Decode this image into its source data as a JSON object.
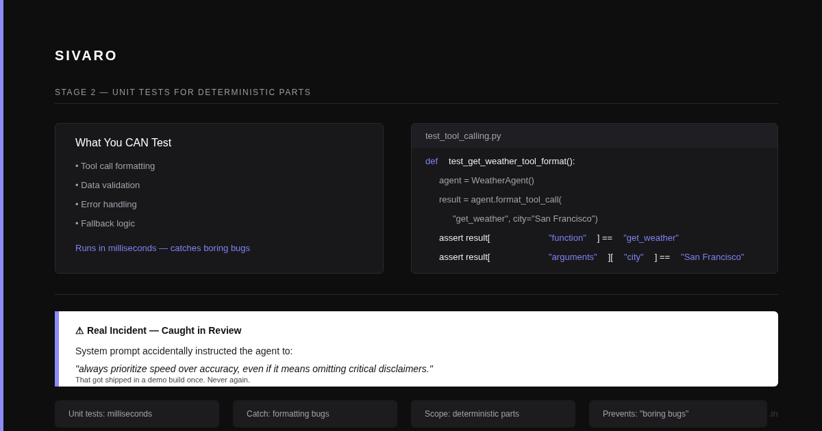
{
  "brand": {
    "name": "SIVARO"
  },
  "section": {
    "title": "STAGE 2 — UNIT TESTS FOR DETERMINISTIC PARTS"
  },
  "capabilities_card": {
    "title": "What You CAN Test",
    "items": [
      "• Tool call formatting",
      "• Data validation",
      "• Error handling",
      "• Fallback logic"
    ],
    "note": "Runs in milliseconds — catches boring bugs"
  },
  "code_panel": {
    "filename": "test_tool_calling.py",
    "lines": [
      {
        "tokens": [
          {
            "kind": "keyword",
            "text": "def"
          },
          {
            "kind": "call",
            "text": "test_get_weather_tool_format():"
          }
        ],
        "children": [
          {
            "tokens": [
              {
                "kind": "plain",
                "text": "agent = WeatherAgent()"
              }
            ]
          },
          {
            "tokens": [
              {
                "kind": "plain",
                "text": "result = agent.format_tool_call("
              }
            ],
            "children": [
              {
                "tokens": [
                  {
                    "kind": "plain",
                    "text": "\"get_weather\", city=\"San Francisco\")"
                  }
                ]
              }
            ]
          },
          {
            "tokens": [
              {
                "kind": "statement",
                "text": "assert result["
              },
              {
                "kind": "string",
                "text": "\"function\""
              },
              {
                "kind": "op",
                "text": "] =="
              },
              {
                "kind": "string",
                "text": "\"get_weather\""
              }
            ]
          },
          {
            "tokens": [
              {
                "kind": "statement",
                "text": "assert result["
              },
              {
                "kind": "string",
                "text": "\"arguments\""
              },
              {
                "kind": "op",
                "text": "]["
              },
              {
                "kind": "string",
                "text": "\"city\""
              },
              {
                "kind": "op",
                "text": "] =="
              },
              {
                "kind": "string",
                "text": "\"San Francisco\""
              }
            ]
          }
        ]
      }
    ]
  },
  "incident": {
    "title": "⚠ Real Incident — Caught in Review",
    "body": "System prompt accidentally instructed the agent to:",
    "quote": "\"always prioritize speed over accuracy, even if it means omitting critical disclaimers.\"",
    "footnote": "That got shipped in a demo build once. Never again."
  },
  "stats": [
    "Unit tests: milliseconds",
    "Catch: formatting bugs",
    "Scope: deterministic parts",
    "Prevents: \"boring bugs\""
  ],
  "footer_text": ".in"
}
